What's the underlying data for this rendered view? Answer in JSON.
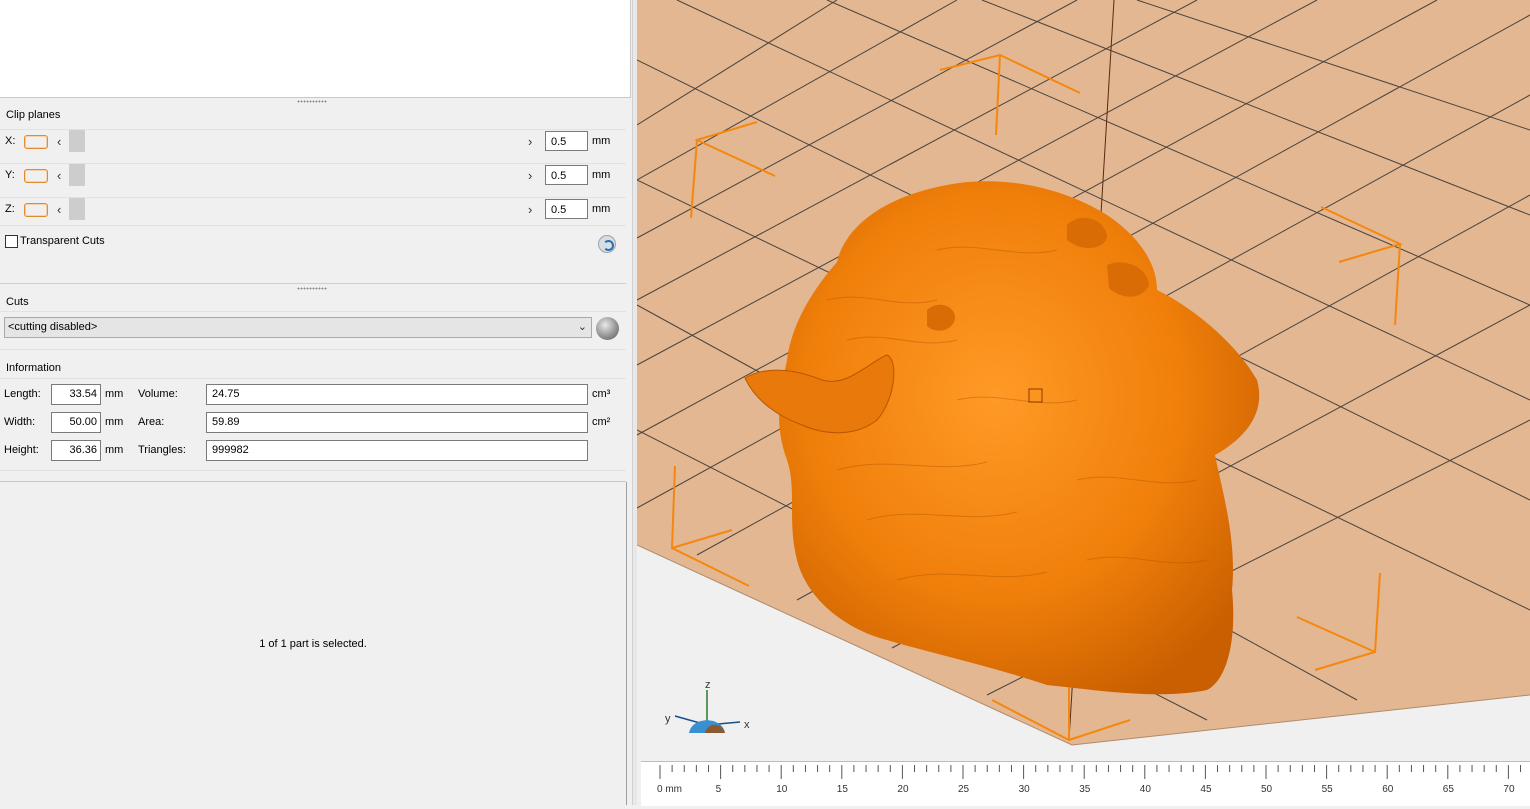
{
  "clip_planes": {
    "title": "Clip planes",
    "rows": [
      {
        "axis": "X:",
        "value": "0.5",
        "unit": "mm"
      },
      {
        "axis": "Y:",
        "value": "0.5",
        "unit": "mm"
      },
      {
        "axis": "Z:",
        "value": "0.5",
        "unit": "mm"
      }
    ],
    "transparent_cuts_label": "Transparent Cuts"
  },
  "cuts": {
    "title": "Cuts",
    "selected": "<cutting disabled>"
  },
  "information": {
    "title": "Information",
    "length_label": "Length:",
    "length_value": "33.54",
    "length_unit": "mm",
    "width_label": "Width:",
    "width_value": "50.00",
    "width_unit": "mm",
    "height_label": "Height:",
    "height_value": "36.36",
    "height_unit": "mm",
    "volume_label": "Volume:",
    "volume_value": "24.75",
    "volume_unit": "cm³",
    "area_label": "Area:",
    "area_value": "59.89",
    "area_unit": "cm²",
    "triangles_label": "Triangles:",
    "triangles_value": "999982"
  },
  "status": "1 of 1 part is selected.",
  "axes_gizmo": {
    "x": "x",
    "y": "y",
    "z": "z"
  },
  "ruler": {
    "labels": [
      "0 mm",
      "5",
      "10",
      "15",
      "20",
      "25",
      "30",
      "35",
      "40",
      "45",
      "50",
      "55",
      "60",
      "65",
      "70"
    ]
  },
  "colors": {
    "model": "#f5870f",
    "bed": "#e2b792",
    "highlight": "#e48a2e"
  }
}
